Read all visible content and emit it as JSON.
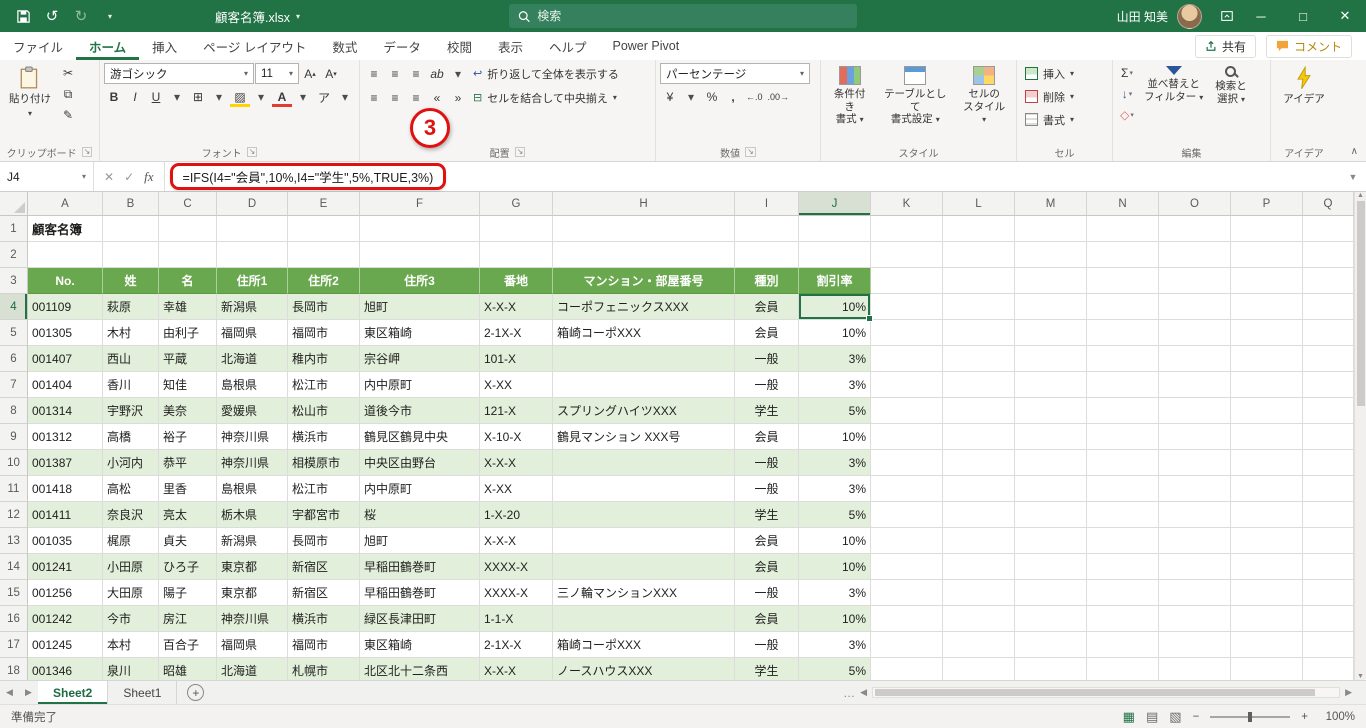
{
  "colors": {
    "titlebar_green": "#217346",
    "table_header_green": "#69a84e",
    "band_green": "#e2efda",
    "annotation_red": "#e01111"
  },
  "titlebar": {
    "title": "顧客名簿.xlsx",
    "search_placeholder": "検索",
    "user_name": "山田 知美"
  },
  "ribbon_tabs": [
    {
      "label": "ファイル"
    },
    {
      "label": "ホーム"
    },
    {
      "label": "挿入"
    },
    {
      "label": "ページ レイアウト"
    },
    {
      "label": "数式"
    },
    {
      "label": "データ"
    },
    {
      "label": "校閲"
    },
    {
      "label": "表示"
    },
    {
      "label": "ヘルプ"
    },
    {
      "label": "Power Pivot"
    }
  ],
  "tab_actions": {
    "share": "共有",
    "comment": "コメント"
  },
  "ribbon": {
    "paste": "貼り付け",
    "clipboard_group": "クリップボード",
    "font_name": "游ゴシック",
    "font_size": "11",
    "font_group": "フォント",
    "wrap_text": "折り返して全体を表示する",
    "merge_center": "セルを結合して中央揃え",
    "alignment_group": "配置",
    "number_format": "パーセンテージ",
    "number_group": "数値",
    "conditional_line1": "条件付き",
    "conditional_line2": "書式",
    "format_table_line1": "テーブルとして",
    "format_table_line2": "書式設定",
    "cell_styles_line1": "セルの",
    "cell_styles_line2": "スタイル",
    "styles_group": "スタイル",
    "insert": "挿入",
    "delete": "削除",
    "format": "書式",
    "cells_group": "セル",
    "sort_line1": "並べ替えと",
    "sort_line2": "フィルター",
    "find_line1": "検索と",
    "find_line2": "選択",
    "editing_group": "編集",
    "ideas": "アイデア",
    "ideas_group": "アイデア"
  },
  "formula_bar": {
    "name_box": "J4",
    "formula": "=IFS(I4=\"会員\",10%,I4=\"学生\",5%,TRUE,3%)"
  },
  "annotation": {
    "number": "3"
  },
  "sheet": {
    "columns": [
      "A",
      "B",
      "C",
      "D",
      "E",
      "F",
      "G",
      "H",
      "I",
      "J",
      "K",
      "L",
      "M",
      "N",
      "O",
      "P",
      "Q"
    ],
    "selected_column": "J",
    "selected_row": 4,
    "selected_cell": "J4",
    "title_cell": "顧客名簿",
    "table_headers": [
      "No.",
      "姓",
      "名",
      "住所1",
      "住所2",
      "住所3",
      "番地",
      "マンション・部屋番号",
      "種別",
      "割引率"
    ],
    "rows": [
      [
        "001109",
        "萩原",
        "幸雄",
        "新潟県",
        "長岡市",
        "旭町",
        "X-X-X",
        "コーポフェニックスXXX",
        "会員",
        "10%"
      ],
      [
        "001305",
        "木村",
        "由利子",
        "福岡県",
        "福岡市",
        "東区箱崎",
        "2-1X-X",
        "箱崎コーポXXX",
        "会員",
        "10%"
      ],
      [
        "001407",
        "西山",
        "平蔵",
        "北海道",
        "稚内市",
        "宗谷岬",
        "101-X",
        "",
        "一般",
        "3%"
      ],
      [
        "001404",
        "香川",
        "知佳",
        "島根県",
        "松江市",
        "内中原町",
        "X-XX",
        "",
        "一般",
        "3%"
      ],
      [
        "001314",
        "宇野沢",
        "美奈",
        "愛媛県",
        "松山市",
        "道後今市",
        "121-X",
        "スプリングハイツXXX",
        "学生",
        "5%"
      ],
      [
        "001312",
        "高橋",
        "裕子",
        "神奈川県",
        "横浜市",
        "鶴見区鶴見中央",
        "X-10-X",
        "鶴見マンション XXX号",
        "会員",
        "10%"
      ],
      [
        "001387",
        "小河内",
        "恭平",
        "神奈川県",
        "相模原市",
        "中央区由野台",
        "X-X-X",
        "",
        "一般",
        "3%"
      ],
      [
        "001418",
        "高松",
        "里香",
        "島根県",
        "松江市",
        "内中原町",
        "X-XX",
        "",
        "一般",
        "3%"
      ],
      [
        "001411",
        "奈良沢",
        "亮太",
        "栃木県",
        "宇都宮市",
        "桜",
        "1-X-20",
        "",
        "学生",
        "5%"
      ],
      [
        "001035",
        "梶原",
        "貞夫",
        "新潟県",
        "長岡市",
        "旭町",
        "X-X-X",
        "",
        "会員",
        "10%"
      ],
      [
        "001241",
        "小田原",
        "ひろ子",
        "東京都",
        "新宿区",
        "早稲田鶴巻町",
        "XXXX-X",
        "",
        "会員",
        "10%"
      ],
      [
        "001256",
        "大田原",
        "陽子",
        "東京都",
        "新宿区",
        "早稲田鶴巻町",
        "XXXX-X",
        "三ノ輪マンションXXX",
        "一般",
        "3%"
      ],
      [
        "001242",
        "今市",
        "房江",
        "神奈川県",
        "横浜市",
        "緑区長津田町",
        "1-1-X",
        "",
        "会員",
        "10%"
      ],
      [
        "001245",
        "本村",
        "百合子",
        "福岡県",
        "福岡市",
        "東区箱崎",
        "2-1X-X",
        "箱崎コーポXXX",
        "一般",
        "3%"
      ],
      [
        "001346",
        "泉川",
        "昭雄",
        "北海道",
        "札幌市",
        "北区北十二条西",
        "X-X-X",
        "ノースハウスXXX",
        "学生",
        "5%"
      ]
    ]
  },
  "sheet_tabs": [
    {
      "label": "Sheet2",
      "active": true
    },
    {
      "label": "Sheet1",
      "active": false
    }
  ],
  "status_bar": {
    "mode": "準備完了",
    "zoom": "100%"
  },
  "icons": {
    "undo": "↺",
    "redo": "↻",
    "dropdown": "▾",
    "collapse": "∧",
    "check": "✓",
    "cross": "✕",
    "fx": "fx",
    "minimize": "─",
    "maximize": "□",
    "close": "✕",
    "bold": "B",
    "italic": "I",
    "underline": "U",
    "borders": "⊞",
    "fill": "▨",
    "font_color": "A",
    "phonetic": "ア",
    "align": "≡",
    "orientation": "ab",
    "wrap": "↩",
    "merge": "⊟",
    "indent_dec": "«",
    "indent_inc": "»",
    "currency": "¥",
    "percent": "%",
    "comma": ",",
    "inc_decimal": "←.0",
    "dec_decimal": ".00→",
    "sum": "Σ",
    "fill_down": "↓",
    "clear": "◇",
    "left_arrow": "◀",
    "right_arrow": "▶",
    "up_arrow": "▲",
    "down_arrow": "▼",
    "plus": "+",
    "ellipsis": "…",
    "view_normal": "▦",
    "view_layout": "▤",
    "view_break": "▧",
    "zoom_out": "−",
    "zoom_in": "+",
    "scissors": "✂",
    "copy": "⧉",
    "brush": "✎"
  }
}
